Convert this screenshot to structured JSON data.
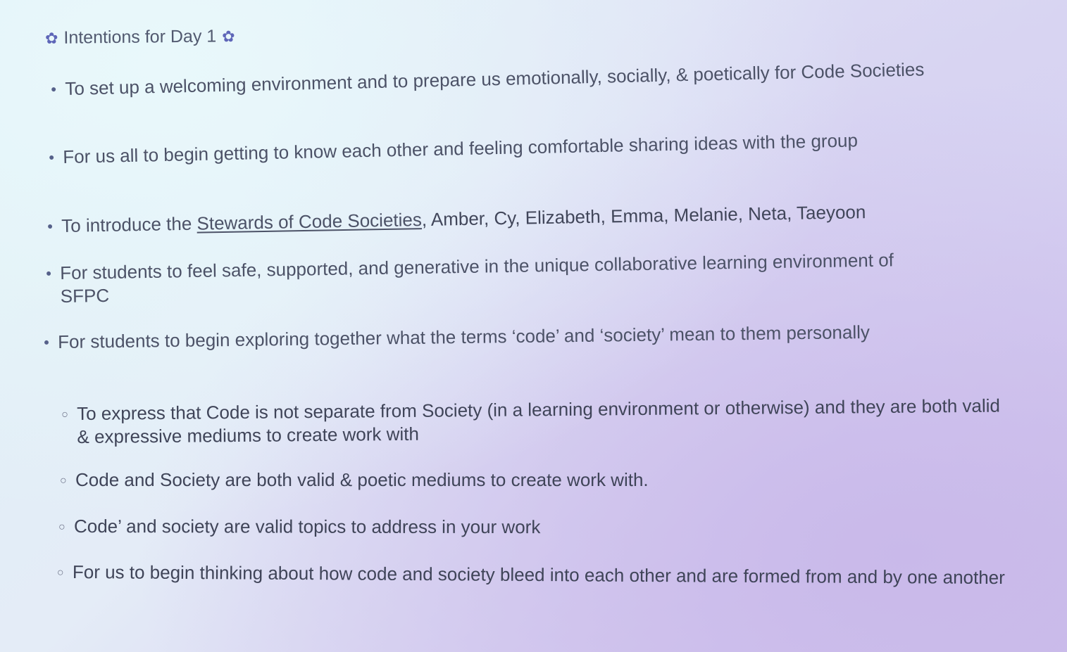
{
  "slide": {
    "title": "Intentions for Day 1",
    "title_icon": "flower-icon",
    "bullets": [
      {
        "text": "To set up a welcoming environment and to prepare us emotionally, socially, & poetically for Code Societies"
      },
      {
        "text": "For us all to begin getting to know each other and feeling comfortable sharing ideas with the group"
      },
      {
        "prefix": "To introduce the ",
        "link": "Stewards of Code Societies",
        "suffix": ", Amber, Cy, Elizabeth, Emma, Melanie, Neta, Taeyoon"
      },
      {
        "text": "For students to feel safe, supported, and generative in the unique collaborative learning environment of SFPC"
      },
      {
        "text": "For students to begin exploring together what the terms ‘code’ and ‘society’ mean to them personally"
      }
    ],
    "sub_bullets": [
      {
        "text": "To express that Code is not separate from Society (in a learning environment or otherwise) and they are both valid & expressive mediums to create work with"
      },
      {
        "text": "Code and Society are both valid & poetic mediums to create work with."
      },
      {
        "text": "Code’ and society are valid topics to address in your work"
      },
      {
        "text": "For us to begin thinking about how code and society bleed into each other and are formed from and by one another"
      }
    ]
  },
  "colors": {
    "text": "#4c5267",
    "icon": "#5e66b8",
    "background_start": "#dff1f6",
    "background_end": "#cdbfea"
  }
}
